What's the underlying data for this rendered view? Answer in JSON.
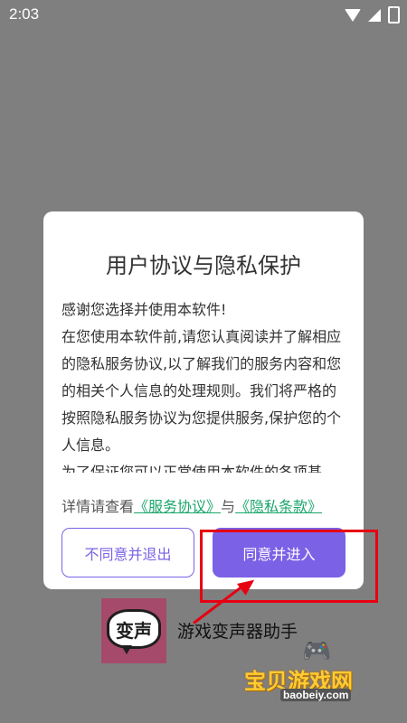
{
  "status_bar": {
    "time": "2:03"
  },
  "dialog": {
    "title": "用户协议与隐私保护",
    "body": [
      "感谢您选择并使用本软件!",
      "在您使用本软件前,请您认真阅读并了解相应的隐私服务协议,以了解我们的服务内容和您的相关个人信息的处理规则。我们将严格的按照隐私服务协议为您提供服务,保护您的个人信息。",
      "为了保证您可以正常使用本软件的各项基"
    ],
    "details_prefix": "详情请查看",
    "service_link": "《服务协议》",
    "and_text": "与",
    "privacy_link": "《隐私条款》",
    "decline_label": "不同意并退出",
    "agree_label": "同意并进入"
  },
  "app": {
    "icon_text": "变声",
    "name": "游戏变声器助手"
  },
  "watermark": {
    "text": "宝贝游戏网",
    "url": "baobeiy.com"
  },
  "colors": {
    "accent": "#7b61e6",
    "link": "#1aa66b",
    "highlight": "#e60012",
    "overlay": "#7f7f7f"
  }
}
